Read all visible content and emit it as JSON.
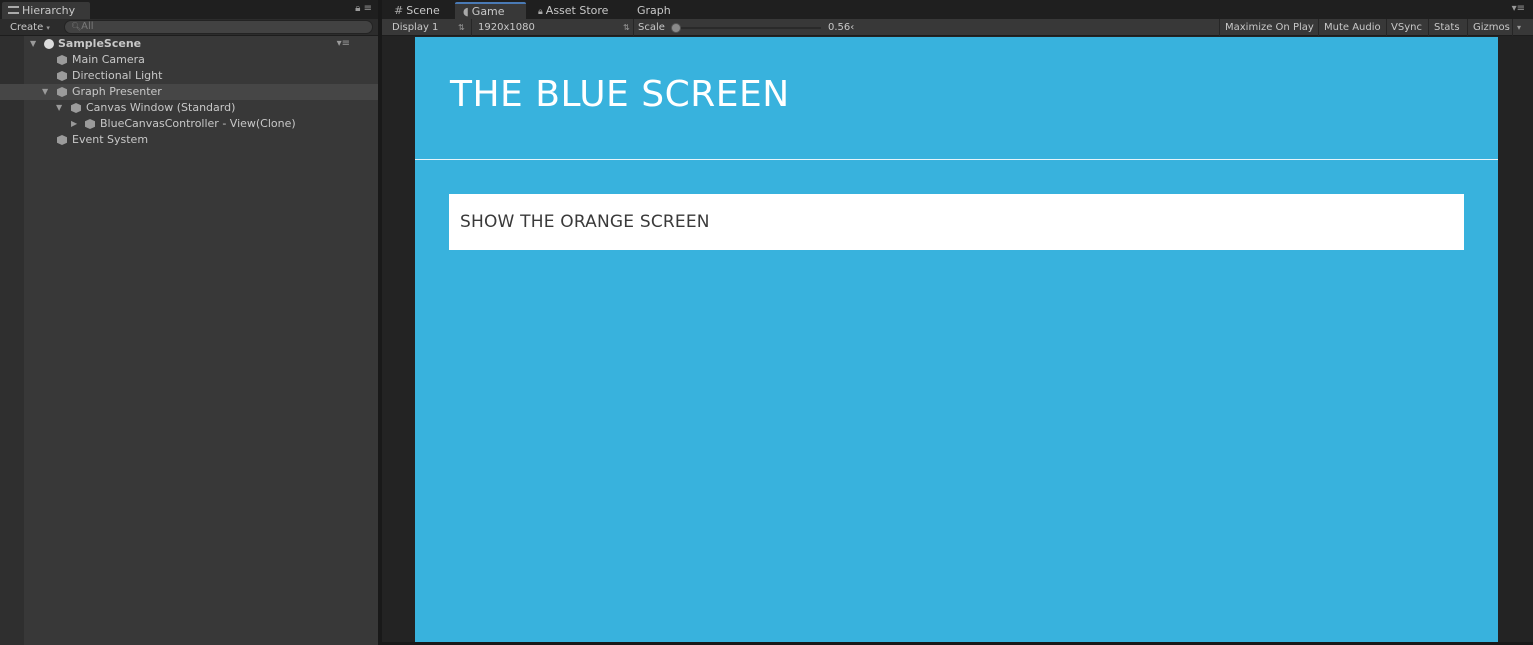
{
  "hierarchy": {
    "tab_label": "Hierarchy",
    "create_label": "Create",
    "search_placeholder": "All",
    "items": [
      {
        "label": "SampleScene",
        "depth": 0,
        "expanded": true,
        "type": "scene"
      },
      {
        "label": "Main Camera",
        "depth": 1,
        "type": "object"
      },
      {
        "label": "Directional Light",
        "depth": 1,
        "type": "object"
      },
      {
        "label": "Graph Presenter",
        "depth": 1,
        "expanded": true,
        "type": "object",
        "selected": true
      },
      {
        "label": "Canvas Window (Standard)",
        "depth": 2,
        "expanded": true,
        "type": "object"
      },
      {
        "label": "BlueCanvasController - View(Clone)",
        "depth": 3,
        "expanded": false,
        "type": "object"
      },
      {
        "label": "Event System",
        "depth": 1,
        "type": "object"
      }
    ]
  },
  "game_panel": {
    "tabs": [
      {
        "label": "Scene",
        "icon": "grid-icon",
        "active": false
      },
      {
        "label": "Game",
        "icon": "pacman-icon",
        "active": true
      },
      {
        "label": "Asset Store",
        "icon": "lock-icon",
        "active": false
      },
      {
        "label": "Graph",
        "icon": "",
        "active": false
      }
    ],
    "toolbar": {
      "display": "Display 1",
      "resolution": "1920x1080",
      "scale_label": "Scale",
      "scale_value": "0.56‹",
      "maximize": "Maximize On Play",
      "mute": "Mute Audio",
      "vsync": "VSync",
      "stats": "Stats",
      "gizmos": "Gizmos"
    }
  },
  "viewport": {
    "background_color": "#38b2dd",
    "title": "THE BLUE SCREEN",
    "button_label": "SHOW THE ORANGE SCREEN"
  },
  "colors": {
    "accent": "#4a7ab5",
    "panel": "#383838",
    "selected_row": "#464646"
  }
}
